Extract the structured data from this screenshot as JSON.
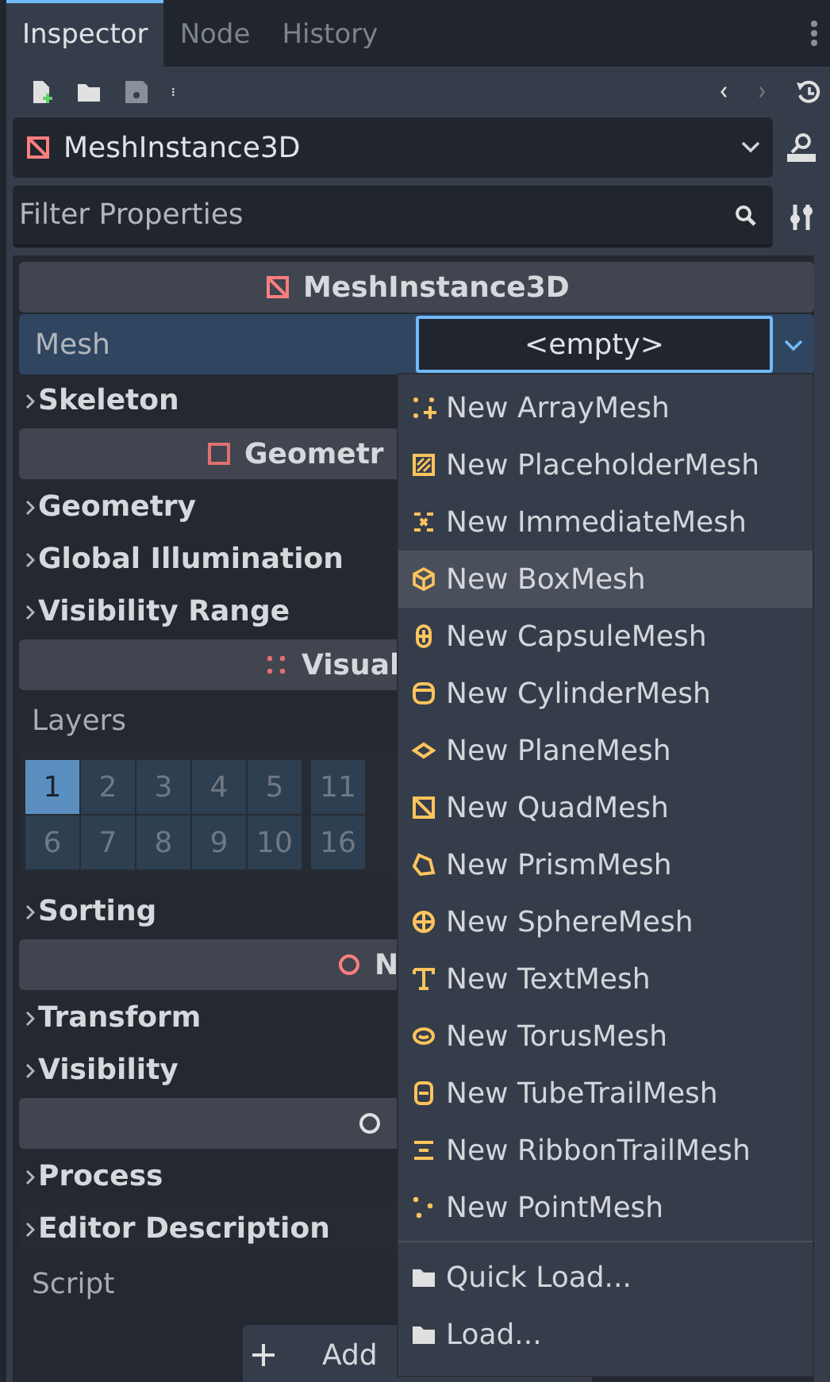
{
  "tabs": [
    {
      "label": "Inspector",
      "selected": true
    },
    {
      "label": "Node",
      "selected": false
    },
    {
      "label": "History",
      "selected": false
    }
  ],
  "class_selector": {
    "value": "MeshInstance3D"
  },
  "filter": {
    "placeholder": "Filter Properties"
  },
  "sections": [
    {
      "kind": "category",
      "title": "MeshInstance3D"
    },
    {
      "kind": "property",
      "label": "Mesh",
      "value": "<empty>",
      "focused": true
    },
    {
      "kind": "group",
      "label": "Skeleton"
    },
    {
      "kind": "category",
      "title": "Geometr"
    },
    {
      "kind": "group",
      "label": "Geometry"
    },
    {
      "kind": "group",
      "label": "Global Illumination"
    },
    {
      "kind": "group",
      "label": "Visibility Range"
    },
    {
      "kind": "category",
      "title": "Visual"
    },
    {
      "kind": "layers",
      "label": "Layers",
      "cells": [
        {
          "label": "1",
          "selected": true
        },
        {
          "label": "2",
          "selected": false
        },
        {
          "label": "3",
          "selected": false
        },
        {
          "label": "4",
          "selected": false
        },
        {
          "label": "5",
          "selected": false
        },
        {
          "label": "11",
          "selected": false
        },
        {
          "label": "6",
          "selected": false
        },
        {
          "label": "7",
          "selected": false
        },
        {
          "label": "8",
          "selected": false
        },
        {
          "label": "9",
          "selected": false
        },
        {
          "label": "10",
          "selected": false
        },
        {
          "label": "16",
          "selected": false
        }
      ]
    },
    {
      "kind": "group",
      "label": "Sorting"
    },
    {
      "kind": "category",
      "title": "N"
    },
    {
      "kind": "group",
      "label": "Transform"
    },
    {
      "kind": "group",
      "label": "Visibility"
    },
    {
      "kind": "category"
    },
    {
      "kind": "group",
      "label": "Process"
    },
    {
      "kind": "group",
      "label": "Editor Description"
    },
    {
      "kind": "script",
      "label": "Script",
      "button": "Add"
    }
  ],
  "menu": {
    "new_items": [
      {
        "label": "New ArrayMesh",
        "highlighted": false
      },
      {
        "label": "New PlaceholderMesh",
        "highlighted": false
      },
      {
        "label": "New ImmediateMesh",
        "highlighted": false
      },
      {
        "label": "New BoxMesh",
        "highlighted": true
      },
      {
        "label": "New CapsuleMesh",
        "highlighted": false
      },
      {
        "label": "New CylinderMesh",
        "highlighted": false
      },
      {
        "label": "New PlaneMesh",
        "highlighted": false
      },
      {
        "label": "New QuadMesh",
        "highlighted": false
      },
      {
        "label": "New PrismMesh",
        "highlighted": false
      },
      {
        "label": "New SphereMesh",
        "highlighted": false
      },
      {
        "label": "New TextMesh",
        "highlighted": false
      },
      {
        "label": "New TorusMesh",
        "highlighted": false
      },
      {
        "label": "New TubeTrailMesh",
        "highlighted": false
      },
      {
        "label": "New RibbonTrailMesh",
        "highlighted": false
      },
      {
        "label": "New PointMesh",
        "highlighted": false
      }
    ],
    "load_items": [
      {
        "label": "Quick Load...",
        "highlighted": false
      },
      {
        "label": "Load...",
        "highlighted": false
      }
    ]
  }
}
